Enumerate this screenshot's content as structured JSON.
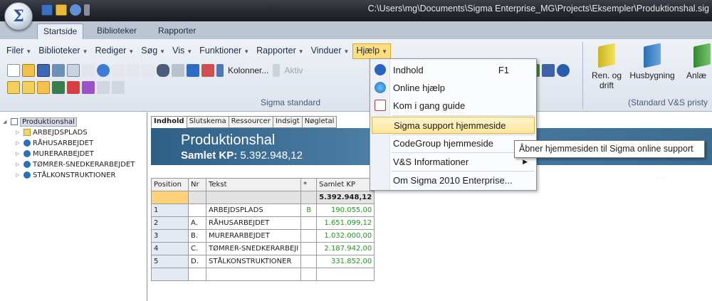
{
  "window": {
    "title": "C:\\Users\\mg\\Documents\\Sigma Enterprise_MG\\Projects\\Eksempler\\Produktionshal.sig",
    "logo_symbol": "Σ"
  },
  "ribbon_tabs": [
    {
      "label": "Startside",
      "active": true
    },
    {
      "label": "Biblioteker",
      "active": false
    },
    {
      "label": "Rapporter",
      "active": false
    }
  ],
  "menubar": [
    {
      "label": "Filer"
    },
    {
      "label": "Biblioteker"
    },
    {
      "label": "Rediger"
    },
    {
      "label": "Søg"
    },
    {
      "label": "Vis"
    },
    {
      "label": "Funktioner"
    },
    {
      "label": "Rapporter"
    },
    {
      "label": "Vinduer"
    },
    {
      "label": "Hjælp",
      "open": true
    }
  ],
  "toolbar": {
    "kolonner_label": "Kolonner...",
    "aktiv_label": "Aktiv",
    "group_label": "Sigma standard"
  },
  "right_group": {
    "buttons": [
      "Ren. og drift",
      "Husbygning",
      "Anlæ"
    ],
    "label": "(Standard V&S pristy"
  },
  "help_menu": {
    "items": [
      {
        "label": "Indhold",
        "shortcut": "F1",
        "icon": "help-circle-icon"
      },
      {
        "label": "Online hjælp",
        "icon": "globe-icon"
      },
      {
        "label": "Kom i gang guide",
        "icon": "document-pdf-icon"
      },
      {
        "label": "Sigma support hjemmeside",
        "highlighted": true
      },
      {
        "label": "CodeGroup hjemmeside"
      },
      {
        "label": "V&S Informationer",
        "submenu": true
      },
      {
        "label": "Om Sigma 2010 Enterprise..."
      }
    ]
  },
  "tooltip": "Åbner hjemmesiden til Sigma online support",
  "tree": {
    "root": "Produktionshal",
    "children": [
      "ARBEJDSPLADS",
      "RÅHUSARBEJDET",
      "MURERARBEJDET",
      "TØMRER-SNEDKERARBEJDET",
      "STÅLKONSTRUKTIONER"
    ]
  },
  "doc_tabs": [
    {
      "label": "Indhold",
      "active": true
    },
    {
      "label": "Slutskema"
    },
    {
      "label": "Ressourcer"
    },
    {
      "label": "Indsigt"
    },
    {
      "label": "Nøgletal"
    }
  ],
  "banner": {
    "title": "Produktionshal",
    "sub_label": "Samlet KP:",
    "sub_value": "5.392.948,12"
  },
  "grid": {
    "headers": [
      "Position",
      "Nr",
      "Tekst",
      "*",
      "Samlet KP"
    ],
    "total": "5.392.948,12",
    "rows": [
      {
        "position": "1",
        "nr": "",
        "tekst": "ARBEJDSPLADS",
        "star": "B",
        "kp": "190.055,00"
      },
      {
        "position": "2",
        "nr": "A.",
        "tekst": "RÅHUSARBEJDET",
        "star": "",
        "kp": "1.651.099,12"
      },
      {
        "position": "3",
        "nr": "B.",
        "tekst": "MURERARBEJDET",
        "star": "",
        "kp": "1.032.000,00"
      },
      {
        "position": "4",
        "nr": "C.",
        "tekst": "TØMRER-SNEDKERARBEJI",
        "star": "",
        "kp": "2.187.942,00"
      },
      {
        "position": "5",
        "nr": "D.",
        "tekst": "STÅLKONSTRUKTIONER",
        "star": "",
        "kp": "331.852,00"
      }
    ]
  },
  "colors": {
    "accent_menu": "#ffde7d",
    "banner": "#3b6c92",
    "value_green": "#1e9a1e"
  }
}
